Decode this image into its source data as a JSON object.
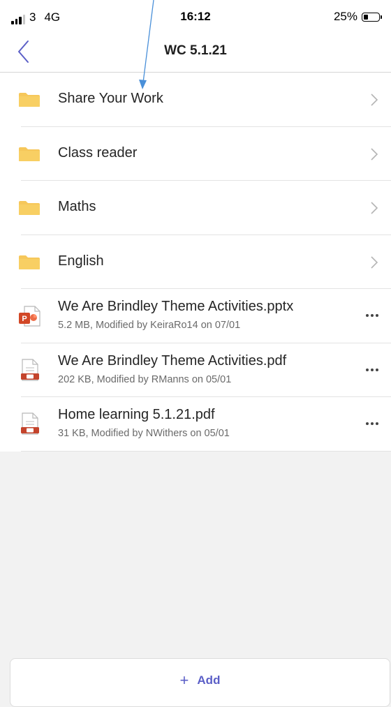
{
  "status_bar": {
    "carrier": "3",
    "network": "4G",
    "time": "16:12",
    "battery": "25%",
    "battery_level": 0.25
  },
  "header": {
    "title": "WC 5.1.21",
    "back_icon": "chevron-left-icon"
  },
  "folders": [
    {
      "label": "Share Your Work",
      "icon": "folder-icon"
    },
    {
      "label": "Class reader",
      "icon": "folder-icon"
    },
    {
      "label": "Maths",
      "icon": "folder-icon"
    },
    {
      "label": "English",
      "icon": "folder-icon"
    }
  ],
  "files": [
    {
      "name": "We Are Brindley Theme Activities.pptx",
      "meta": "5.2 MB, Modified by KeiraRo14 on 07/01",
      "icon": "powerpoint-icon"
    },
    {
      "name": "We Are Brindley Theme Activities.pdf",
      "meta": "202 KB, Modified by RManns on 05/01",
      "icon": "pdf-icon"
    },
    {
      "name": "Home learning 5.1.21.pdf",
      "meta": "31 KB, Modified by NWithers on 05/01",
      "icon": "pdf-icon"
    }
  ],
  "add_button": {
    "label": "Add",
    "icon": "plus-icon"
  },
  "colors": {
    "folder": "#f6c75a",
    "accent": "#5b5fc7",
    "pptx": "#d24726",
    "pdf": "#c4442c",
    "annotation_arrow": "#4a90d9"
  }
}
